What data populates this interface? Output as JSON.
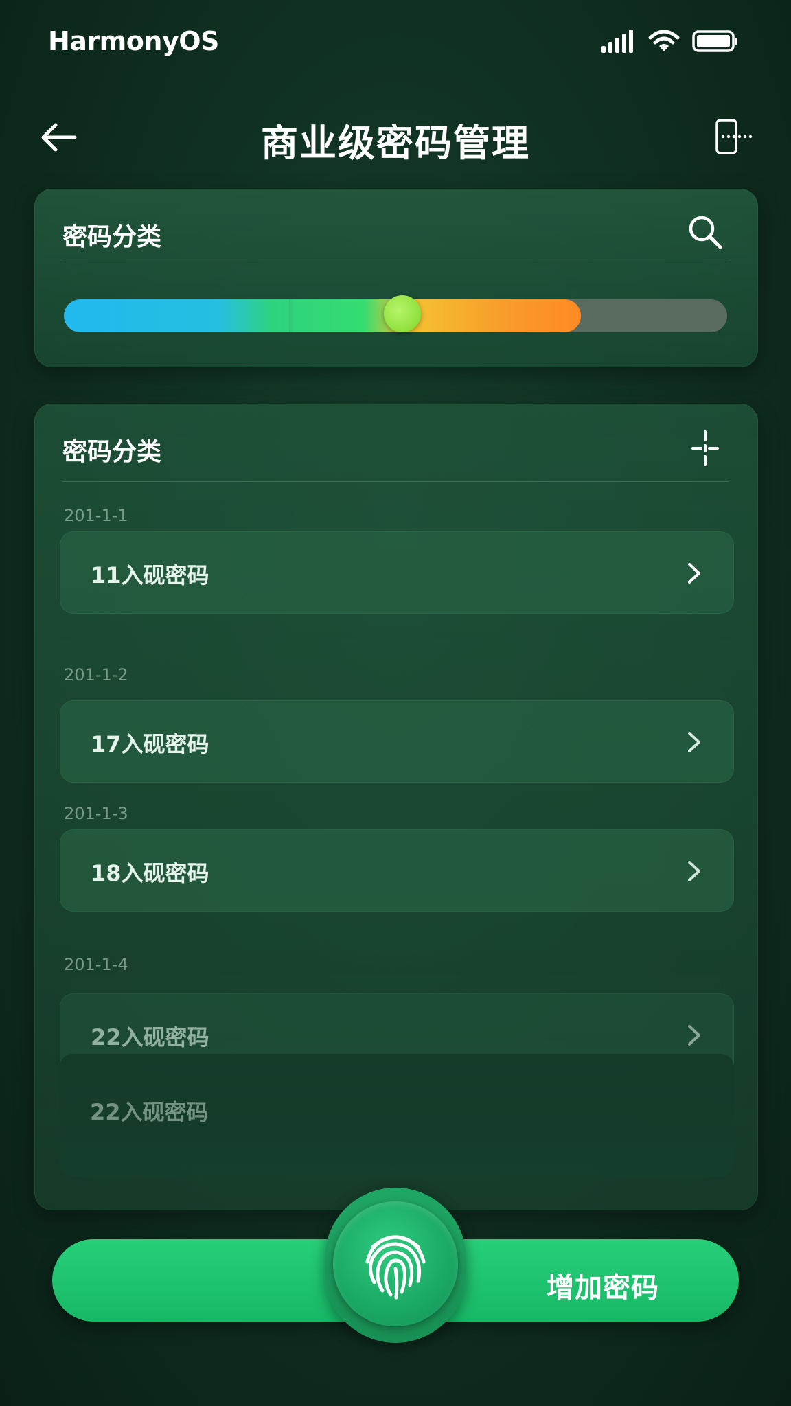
{
  "status_bar": {
    "os_name": "HarmonyOS"
  },
  "header": {
    "title": "商业级密码管理"
  },
  "category_card": {
    "title": "密码分类",
    "slider_value_fraction": 0.51,
    "colors": {
      "blue": "#21b9ee",
      "green": "#35dc70",
      "yellow": "#f5c531",
      "orange": "#ff8a24",
      "thumb": "#8fe03d"
    }
  },
  "list_card": {
    "title": "密码分类",
    "groups": [
      {
        "date": "201-1-1",
        "item": "11入砚密码"
      },
      {
        "date": "201-1-2",
        "item": "17入砚密码"
      },
      {
        "date": "201-1-3",
        "item": "18入砚密码"
      },
      {
        "date": "201-1-4",
        "item": "22入砚密码"
      }
    ],
    "overflow_item": "22入砚密码"
  },
  "bottom_bar": {
    "add_label": "增加密码",
    "accent": "#1ec270"
  },
  "icons": {
    "back": "arrow-left-icon",
    "header_action": "screen-split-icon",
    "search": "search-icon",
    "sort": "sort-icon",
    "chevron": "chevron-right-icon",
    "fingerprint": "fingerprint-icon"
  }
}
